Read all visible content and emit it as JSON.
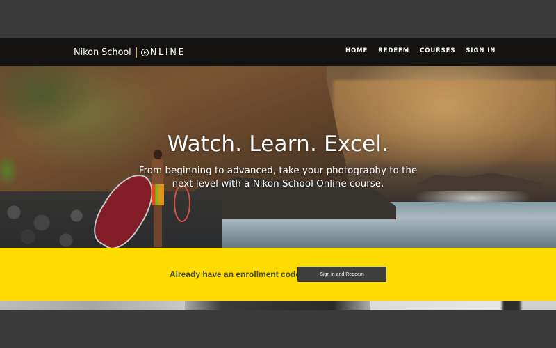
{
  "header": {
    "logo": {
      "brand": "Nikon School",
      "suffix": "NLINE"
    },
    "nav": [
      {
        "label": "HOME"
      },
      {
        "label": "REDEEM"
      },
      {
        "label": "COURSES"
      },
      {
        "label": "SIGN IN"
      }
    ]
  },
  "hero": {
    "title": "Watch. Learn. Excel.",
    "subtitle": "From beginning to advanced, take your photography to the next level with a Nikon School Online course."
  },
  "enroll": {
    "prompt": "Already have an enrollment code?",
    "button_label": "Sign in and Redeem"
  },
  "colors": {
    "accent_yellow": "#ffdc00",
    "button_dark": "#3e3e3e",
    "header_bg": "#141210",
    "page_frame": "#3a3a3a"
  },
  "icons": {
    "logo_o": "play-circle-icon"
  }
}
